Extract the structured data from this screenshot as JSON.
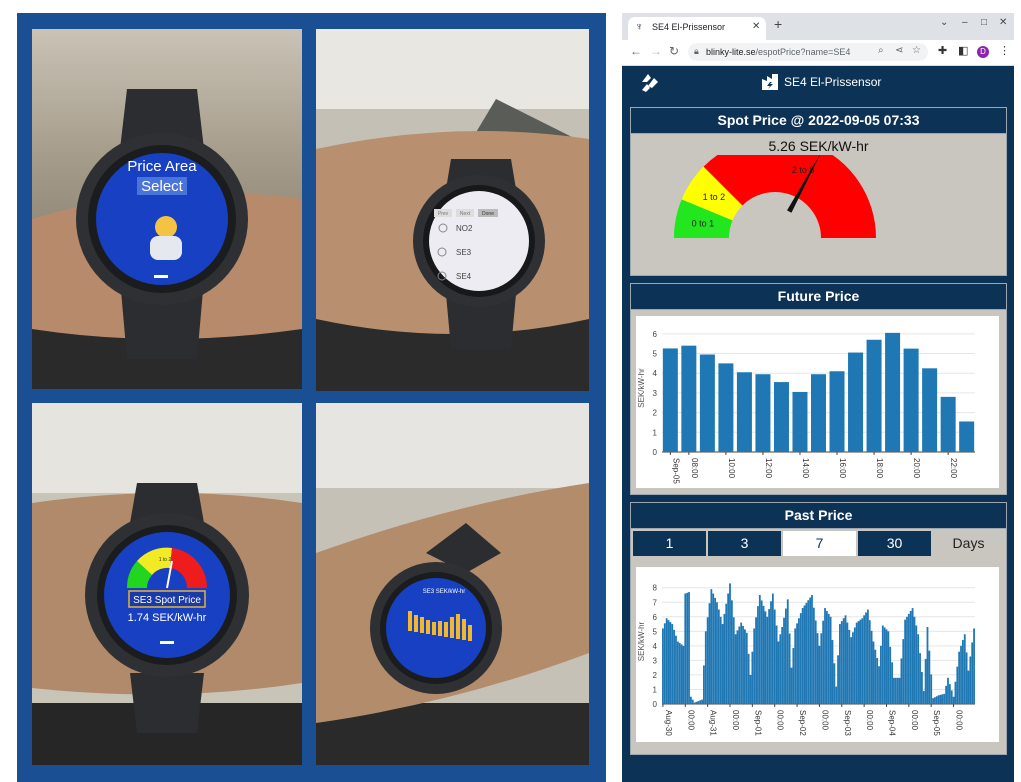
{
  "collage": {
    "watch1": {
      "line1": "Price Area",
      "line2": "Select"
    },
    "watch2": {
      "buttons": [
        "Prev",
        "Next",
        "Done"
      ],
      "options": [
        "NO2",
        "SE3",
        "SE4"
      ]
    },
    "watch3": {
      "gauge_label": "1 to 2",
      "area_label": "SE3 Spot Price",
      "price": "1.74 SEK/kW-hr"
    },
    "watch4": {
      "title": "SE3 SEK/kW-hr"
    }
  },
  "browser": {
    "tab_title": "SE4 El-Prissensor",
    "url_host": "blinky-lite.se",
    "url_path": "/espotPrice?name=SE4",
    "profile_initial": "D"
  },
  "app": {
    "title": "SE4 El-Prissensor",
    "spot": {
      "header": "Spot Price @ 2022-09-05 07:33",
      "value": "5.26 SEK/kW-hr"
    },
    "future": {
      "header": "Future Price"
    },
    "past": {
      "header": "Past Price",
      "ranges": [
        "1",
        "3",
        "7",
        "30"
      ],
      "active_range": "7",
      "unit": "Days"
    }
  },
  "chart_data": [
    {
      "type": "gauge",
      "segments": [
        {
          "label": "0 to 1",
          "from": 0,
          "to": 1,
          "color": "#22e61e"
        },
        {
          "label": "1 to 2",
          "from": 1,
          "to": 2,
          "color": "#ffff00"
        },
        {
          "label": "2 to 8",
          "from": 2,
          "to": 8,
          "color": "#ff0000"
        }
      ],
      "range": [
        0,
        8
      ],
      "value": 5.26
    },
    {
      "type": "bar",
      "ylabel": "SEK/kW-hr",
      "ylim": [
        0,
        6.5
      ],
      "yticks": [
        0,
        1,
        2,
        3,
        4,
        5,
        6
      ],
      "x": [
        7,
        8,
        9,
        10,
        11,
        12,
        13,
        14,
        15,
        16,
        17,
        18,
        19,
        20,
        21,
        22,
        23
      ],
      "values": [
        5.26,
        5.4,
        4.95,
        4.5,
        4.05,
        3.95,
        3.55,
        3.05,
        3.95,
        4.1,
        5.05,
        5.7,
        6.05,
        5.25,
        4.25,
        2.8,
        1.55
      ],
      "xticks": [
        {
          "x": 7,
          "label": "Sep-05"
        },
        {
          "x": 8,
          "label": "08:00"
        },
        {
          "x": 10,
          "label": "10:00"
        },
        {
          "x": 12,
          "label": "12:00"
        },
        {
          "x": 14,
          "label": "14:00"
        },
        {
          "x": 16,
          "label": "16:00"
        },
        {
          "x": 18,
          "label": "18:00"
        },
        {
          "x": 20,
          "label": "20:00"
        },
        {
          "x": 22,
          "label": "22:00"
        }
      ],
      "color": "#1f77b4"
    },
    {
      "type": "bar",
      "ylabel": "SEK/kW-hr",
      "ylim": [
        0,
        8.6
      ],
      "yticks": [
        0,
        1,
        2,
        3,
        4,
        5,
        6,
        7,
        8
      ],
      "days": [
        "Aug-30",
        "Aug-31",
        "Sep-01",
        "Sep-02",
        "Sep-03",
        "Sep-04",
        "Sep-05"
      ],
      "keypoints": [
        [
          0,
          5.2
        ],
        [
          2,
          5.9
        ],
        [
          5,
          5.5
        ],
        [
          8,
          4.3
        ],
        [
          11,
          4.0
        ],
        [
          12,
          7.6
        ],
        [
          14,
          7.7
        ],
        [
          15,
          0.5
        ],
        [
          17,
          0.1
        ],
        [
          19,
          0.2
        ],
        [
          21,
          0.3
        ],
        [
          23,
          5.0
        ],
        [
          26,
          7.9
        ],
        [
          29,
          7.0
        ],
        [
          32,
          5.5
        ],
        [
          36,
          8.3
        ],
        [
          39,
          4.8
        ],
        [
          42,
          5.6
        ],
        [
          45,
          4.9
        ],
        [
          47,
          2.0
        ],
        [
          49,
          5.2
        ],
        [
          52,
          7.5
        ],
        [
          56,
          6.0
        ],
        [
          59,
          7.6
        ],
        [
          62,
          4.3
        ],
        [
          64,
          5.3
        ],
        [
          67,
          7.2
        ],
        [
          69,
          2.5
        ],
        [
          71,
          5.2
        ],
        [
          75,
          6.6
        ],
        [
          80,
          7.5
        ],
        [
          84,
          4.0
        ],
        [
          87,
          6.6
        ],
        [
          90,
          6.0
        ],
        [
          93,
          1.2
        ],
        [
          95,
          5.5
        ],
        [
          98,
          6.1
        ],
        [
          101,
          4.6
        ],
        [
          104,
          5.6
        ],
        [
          107,
          5.9
        ],
        [
          110,
          6.5
        ],
        [
          113,
          4.3
        ],
        [
          116,
          2.6
        ],
        [
          118,
          5.4
        ],
        [
          121,
          5.0
        ],
        [
          124,
          1.8
        ],
        [
          127,
          1.8
        ],
        [
          130,
          5.8
        ],
        [
          134,
          6.6
        ],
        [
          137,
          4.8
        ],
        [
          140,
          0.9
        ],
        [
          142,
          5.3
        ],
        [
          145,
          0.4
        ],
        [
          148,
          0.6
        ],
        [
          151,
          0.7
        ],
        [
          153,
          1.8
        ],
        [
          156,
          0.5
        ],
        [
          159,
          3.6
        ],
        [
          162,
          4.8
        ],
        [
          164,
          2.3
        ],
        [
          167,
          5.2
        ]
      ],
      "xticks": [
        {
          "x": 0,
          "label": "Aug-30"
        },
        {
          "x": 12,
          "label": "00:00"
        },
        {
          "x": 24,
          "label": "Aug-31"
        },
        {
          "x": 36,
          "label": "00:00"
        },
        {
          "x": 48,
          "label": "Sep-01"
        },
        {
          "x": 60,
          "label": "00:00"
        },
        {
          "x": 72,
          "label": "Sep-02"
        },
        {
          "x": 84,
          "label": "00:00"
        },
        {
          "x": 96,
          "label": "Sep-03"
        },
        {
          "x": 108,
          "label": "00:00"
        },
        {
          "x": 120,
          "label": "Sep-04"
        },
        {
          "x": 132,
          "label": "00:00"
        },
        {
          "x": 144,
          "label": "Sep-05"
        },
        {
          "x": 156,
          "label": "00:00"
        }
      ],
      "color": "#1f77b4"
    }
  ]
}
